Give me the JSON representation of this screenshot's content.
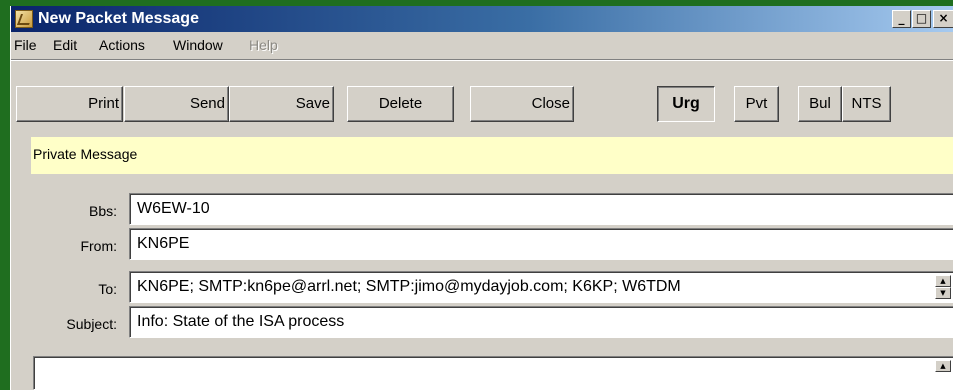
{
  "window": {
    "title": "New Packet Message",
    "minimize_glyph": "_",
    "maximize_glyph": "□",
    "close_glyph": "×"
  },
  "menu": {
    "items": [
      {
        "label": "File",
        "enabled": true
      },
      {
        "label": "Edit",
        "enabled": true
      },
      {
        "label": "Actions",
        "enabled": true
      },
      {
        "label": "Window",
        "enabled": true
      },
      {
        "label": "Help",
        "enabled": false
      }
    ]
  },
  "toolbar": {
    "print": "Print",
    "send": "Send",
    "save": "Save",
    "delete": "Delete",
    "close": "Close",
    "urg": "Urg",
    "pvt": "Pvt",
    "bul": "Bul",
    "nts": "NTS"
  },
  "message_type": "Private Message",
  "form": {
    "bbs": {
      "label": "Bbs:",
      "value": "W6EW-10"
    },
    "from": {
      "label": "From:",
      "value": "KN6PE"
    },
    "to": {
      "label": "To:",
      "value": "KN6PE; SMTP:kn6pe@arrl.net; SMTP:jimo@mydayjob.com; K6KP; W6TDM"
    },
    "subject": {
      "label": "Subject:",
      "value": "Info: State of the ISA process"
    }
  },
  "colors": {
    "desktop": "#1f6e1f",
    "titlebar_start": "#0a246a",
    "titlebar_end": "#a6caf0",
    "private_highlight": "#ffffc8"
  }
}
